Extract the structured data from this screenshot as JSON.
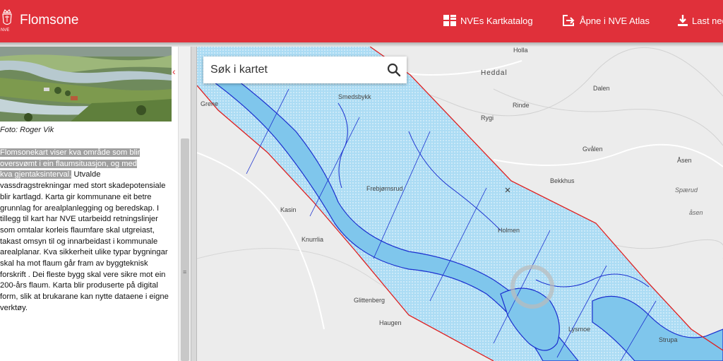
{
  "header": {
    "app_title": "Flomsone",
    "logo_text": "NVE",
    "nav": [
      {
        "label": "NVEs Kartkatalog",
        "icon": "grid-icon"
      },
      {
        "label": "Åpne i NVE Atlas",
        "icon": "open-external-icon"
      },
      {
        "label": "Last ned",
        "icon": "download-icon"
      }
    ],
    "brand_color": "#e0303a"
  },
  "sidebar": {
    "caption": "Foto: Roger Vik",
    "highlight_line1": "Flomsonekart viser kva område som blir",
    "highlight_line2": "oversvømt i ein flaumsituasjon, og med",
    "highlight_line3": "kva gjentaksinterval.",
    "body_text": "Utvalde vassdragstrekningar med stort skadepotensiale blir kartlagd. Karta gir kommunane eit betre grunnlag for arealplanlegging og beredskap. I tillegg til kart har NVE utarbeidd retningslinjer som omtalar korleis flaumfare skal utgreiast, takast omsyn til og innarbeidast i kommunale arealplanar. Kva sikkerheit ulike typar bygningar skal ha mot flaum går fram av byggteknisk forskrift . Dei fleste bygg skal vere sikre mot ein 200-års flaum. Karta blir produserte på digital form, slik at brukarane kan nytte dataene i eigne verktøy."
  },
  "search": {
    "placeholder": "Søk i kartet",
    "icon": "search-icon"
  },
  "map": {
    "places": [
      "Holla",
      "Heddal",
      "Dalen",
      "Grene",
      "Smedsbykk",
      "Rinde",
      "Rygi",
      "Gvålen",
      "Åsen",
      "Bekkhus",
      "Spærud",
      "åsen",
      "Frebjørnsrud",
      "Kasin",
      "Holmen",
      "Knurrlia",
      "Glittenberg",
      "Haugen",
      "Lysmoe",
      "Strupa"
    ],
    "flood_color": "#8fcff0",
    "river_color": "#7fc6ec",
    "outline_color": "#1a2fcf",
    "boundary_color": "#e02020"
  }
}
